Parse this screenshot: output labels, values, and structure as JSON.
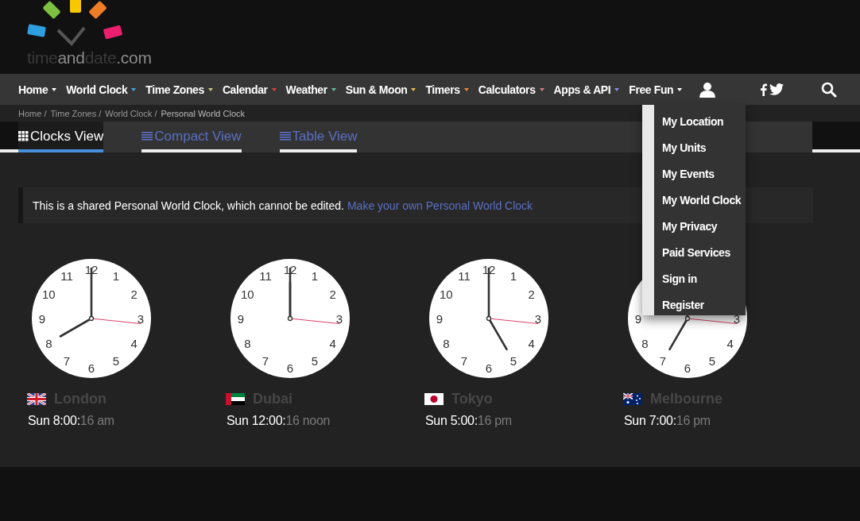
{
  "logo": {
    "parts": [
      "time",
      "and",
      "date",
      ".com"
    ]
  },
  "nav": {
    "items": [
      {
        "label": "Home",
        "color": "#ffffff"
      },
      {
        "label": "World Clock",
        "color": "#4aa3df"
      },
      {
        "label": "Time Zones",
        "color": "#c9c77a"
      },
      {
        "label": "Calendar",
        "color": "#d9423f"
      },
      {
        "label": "Weather",
        "color": "#62b8a4"
      },
      {
        "label": "Sun & Moon",
        "color": "#e6b84a"
      },
      {
        "label": "Timers",
        "color": "#e6873a"
      },
      {
        "label": "Calculators",
        "color": "#d77a8a"
      },
      {
        "label": "Apps & API",
        "color": "#8a8ae6"
      },
      {
        "label": "Free Fun",
        "color": "#ffffff"
      }
    ]
  },
  "breadcrumbs": [
    "Home /",
    "Time Zones /",
    "World Clock /",
    "Personal World Clock"
  ],
  "tabs": [
    {
      "label": "Clocks View",
      "kind": "grid",
      "selected": true
    },
    {
      "label": "Compact View",
      "kind": "list",
      "selected": false
    },
    {
      "label": "Table View",
      "kind": "list",
      "selected": false
    }
  ],
  "notice": {
    "text": "This is a shared Personal World Clock, which cannot be edited.",
    "link": "Make your own Personal World Clock"
  },
  "clocks": [
    {
      "city": "London",
      "kind": "uk",
      "time": "Sun 8:00:",
      "time_rest": "16 am",
      "dial": [
        {
          "label": "12",
          "kind": "h12"
        },
        {
          "label": "1",
          "kind": "h1"
        },
        {
          "label": "2",
          "kind": "h2"
        },
        {
          "label": "3",
          "kind": "h3"
        },
        {
          "label": "4",
          "kind": "h4"
        },
        {
          "label": "5",
          "kind": "h5"
        },
        {
          "label": "6",
          "kind": "h6"
        },
        {
          "label": "7",
          "kind": "h7"
        },
        {
          "label": "8",
          "kind": "h8"
        },
        {
          "label": "9",
          "kind": "h9"
        },
        {
          "label": "10",
          "kind": "h10"
        },
        {
          "label": "11",
          "kind": "h11"
        }
      ]
    },
    {
      "city": "Dubai",
      "kind": "uae",
      "time": "Sun 12:00:",
      "time_rest": "16 noon",
      "dial": [
        {
          "label": "12",
          "kind": "h12"
        },
        {
          "label": "1",
          "kind": "h1"
        },
        {
          "label": "2",
          "kind": "h2"
        },
        {
          "label": "3",
          "kind": "h3"
        },
        {
          "label": "4",
          "kind": "h4"
        },
        {
          "label": "5",
          "kind": "h5"
        },
        {
          "label": "6",
          "kind": "h6"
        },
        {
          "label": "7",
          "kind": "h7"
        },
        {
          "label": "8",
          "kind": "h8"
        },
        {
          "label": "9",
          "kind": "h9"
        },
        {
          "label": "10",
          "kind": "h10"
        },
        {
          "label": "11",
          "kind": "h11"
        }
      ]
    },
    {
      "city": "Tokyo",
      "kind": "japan",
      "time": "Sun 5:00:",
      "time_rest": "16 pm",
      "dial": [
        {
          "label": "12",
          "kind": "h12"
        },
        {
          "label": "1",
          "kind": "h1"
        },
        {
          "label": "2",
          "kind": "h2"
        },
        {
          "label": "3",
          "kind": "h3"
        },
        {
          "label": "4",
          "kind": "h4"
        },
        {
          "label": "5",
          "kind": "h5"
        },
        {
          "label": "6",
          "kind": "h6"
        },
        {
          "label": "7",
          "kind": "h7"
        },
        {
          "label": "8",
          "kind": "h8"
        },
        {
          "label": "9",
          "kind": "h9"
        },
        {
          "label": "10",
          "kind": "h10"
        },
        {
          "label": "11",
          "kind": "h11"
        }
      ]
    },
    {
      "city": "Melbourne",
      "kind": "australia",
      "time": "Sun 7:00:",
      "time_rest": "16 pm",
      "dial": [
        {
          "label": "3",
          "kind": "h3"
        },
        {
          "label": "4",
          "kind": "h4"
        },
        {
          "label": "5",
          "kind": "h5"
        },
        {
          "label": "6",
          "kind": "h6"
        },
        {
          "label": "7",
          "kind": "h7"
        },
        {
          "label": "8",
          "kind": "h8"
        },
        {
          "label": "9",
          "kind": "h9"
        }
      ]
    }
  ],
  "account_menu": {
    "items": [
      "My Location",
      "My Units",
      "My Events",
      "My World Clock",
      "My Privacy",
      "Paid Services",
      "Sign in",
      "Register"
    ]
  }
}
